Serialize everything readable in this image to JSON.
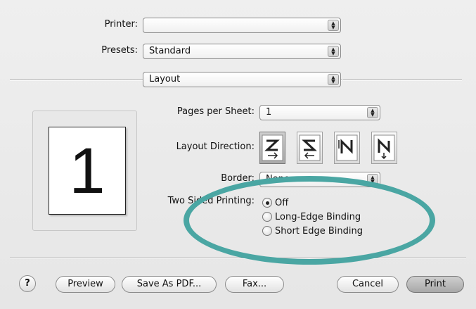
{
  "printer": {
    "label": "Printer:",
    "value": ""
  },
  "presets": {
    "label": "Presets:",
    "value": "Standard"
  },
  "panel": {
    "value": "Layout"
  },
  "pages_per_sheet": {
    "label": "Pages per Sheet:",
    "value": "1"
  },
  "layout_direction": {
    "label": "Layout Direction:",
    "options": [
      "z-order",
      "reverse-z-order",
      "n-order",
      "reverse-n-order"
    ],
    "selected_index": 0
  },
  "border": {
    "label": "Border:",
    "value": "None"
  },
  "two_sided": {
    "label": "Two Sided Printing:",
    "options": [
      {
        "label": "Off",
        "checked": true
      },
      {
        "label": "Long-Edge Binding",
        "checked": false
      },
      {
        "label": "Short Edge Binding",
        "checked": false
      }
    ]
  },
  "preview_page_number": "1",
  "buttons": {
    "help": "?",
    "preview": "Preview",
    "save_pdf": "Save As PDF...",
    "fax": "Fax...",
    "cancel": "Cancel",
    "print": "Print"
  },
  "annotation_color": "#4aa6a3"
}
